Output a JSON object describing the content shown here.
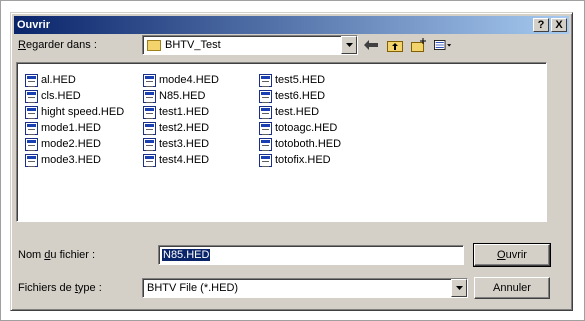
{
  "window": {
    "title": "Ouvrir",
    "help_button": "?",
    "close_button": "X"
  },
  "look_in": {
    "label_prefix": "",
    "label_accel": "R",
    "label_rest": "egarder dans :",
    "value": "BHTV_Test"
  },
  "toolbar": {
    "icons": [
      "back-icon",
      "up-folder-icon",
      "new-folder-icon",
      "view-menu-icon"
    ]
  },
  "files": [
    "al.HED",
    "cls.HED",
    "hight speed.HED",
    "mode1.HED",
    "mode2.HED",
    "mode3.HED",
    "mode4.HED",
    "N85.HED",
    "test1.HED",
    "test2.HED",
    "test3.HED",
    "test4.HED",
    "test5.HED",
    "test6.HED",
    "test.HED",
    "totoagc.HED",
    "totoboth.HED",
    "totofix.HED"
  ],
  "filename": {
    "label_prefix": "Nom ",
    "label_accel": "d",
    "label_rest": "u fichier :",
    "value": "N85.HED"
  },
  "filetype": {
    "label_prefix": "Fichiers de ",
    "label_accel": "t",
    "label_rest": "ype :",
    "value": "BHTV File (*.HED)"
  },
  "buttons": {
    "open_accel": "O",
    "open_rest": "uvrir",
    "cancel": "Annuler"
  }
}
